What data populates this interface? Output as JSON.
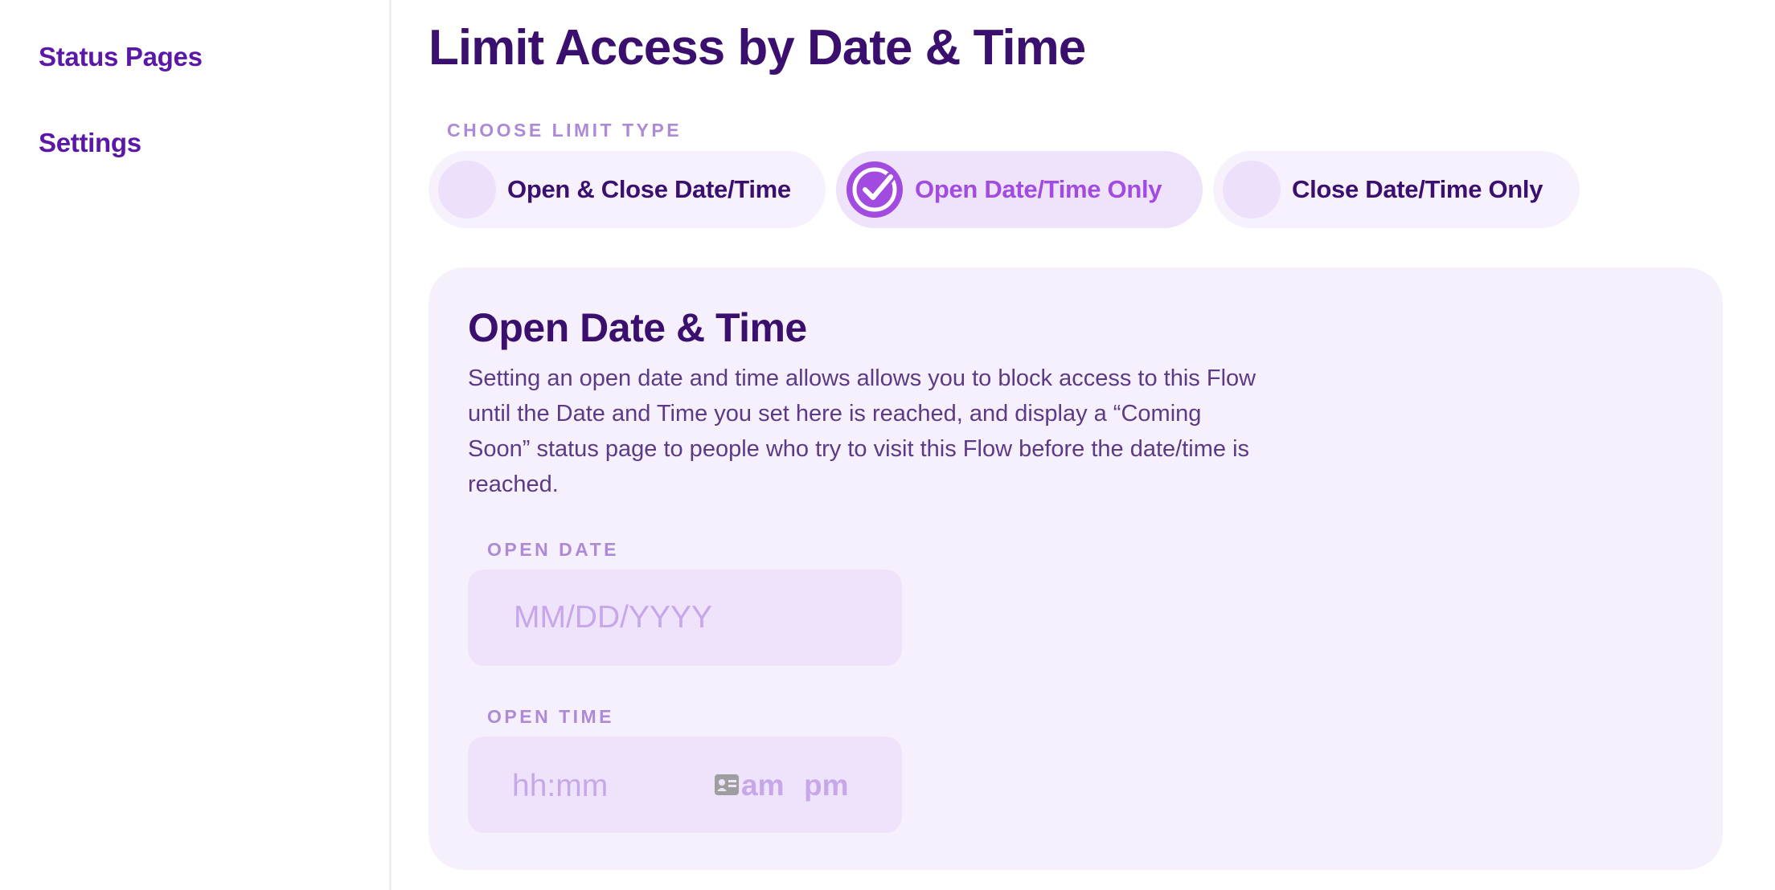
{
  "sidebar": {
    "items": [
      {
        "label": "Status Pages"
      },
      {
        "label": "Settings"
      }
    ]
  },
  "page": {
    "title": "Limit Access by Date & Time"
  },
  "limit_type": {
    "label": "CHOOSE LIMIT TYPE",
    "options": [
      {
        "label": "Open & Close Date/Time",
        "selected": false
      },
      {
        "label": "Open Date/Time Only",
        "selected": true
      },
      {
        "label": "Close Date/Time Only",
        "selected": false
      }
    ]
  },
  "card": {
    "title": "Open Date & Time",
    "description": "Setting an open date and time allows allows you to block access to this Flow until the Date and Time you set here is reached, and display a “Coming Soon” status page to people who try to visit this Flow before the date/time is reached.",
    "open_date": {
      "label": "OPEN DATE",
      "placeholder": "MM/DD/YYYY"
    },
    "open_time": {
      "label": "OPEN TIME",
      "placeholder": "hh:mm",
      "am": "am",
      "pm": "pm",
      "icon": "contact-card-icon"
    }
  },
  "colors": {
    "heading": "#3a0f6e",
    "accent": "#a24be0",
    "sidebar_link": "#5a17a8",
    "card_bg": "#f6f0fd"
  }
}
